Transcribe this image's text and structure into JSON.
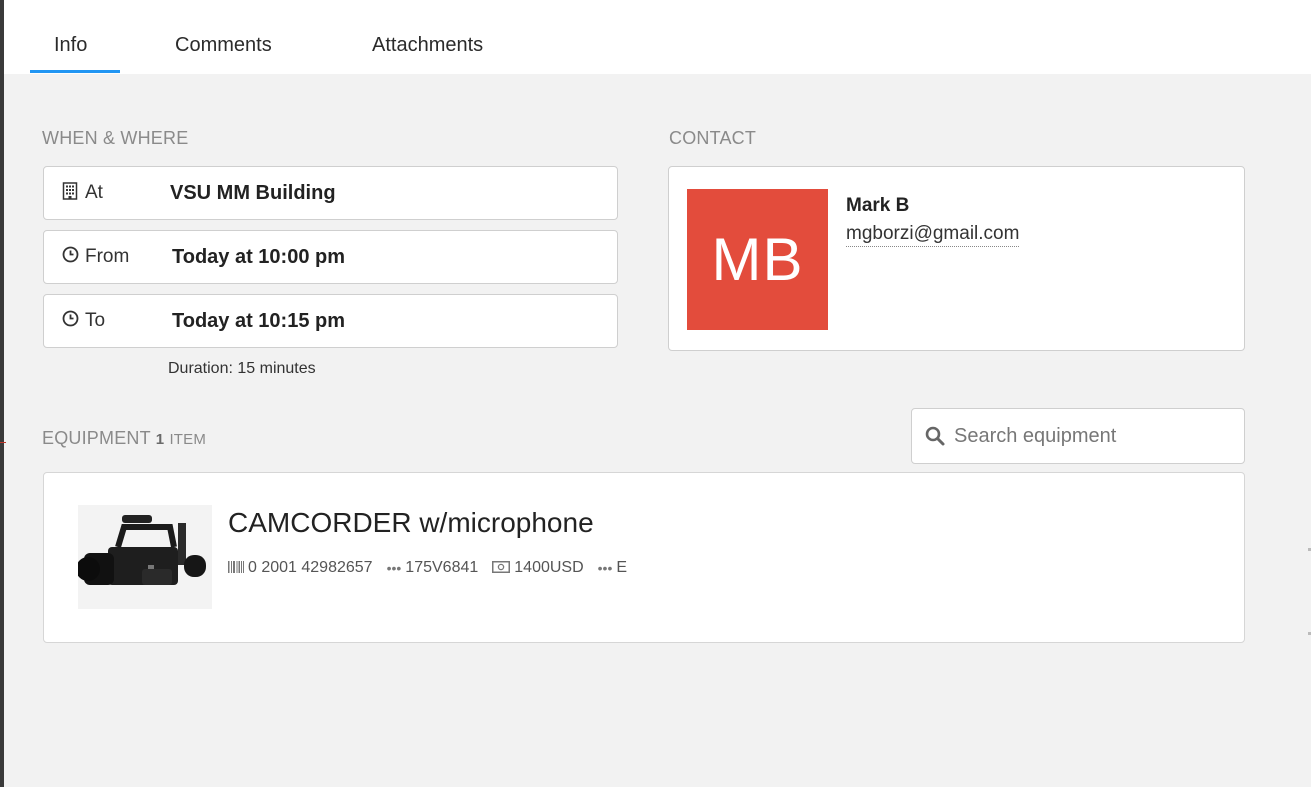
{
  "tabs": [
    {
      "label": "Info",
      "active": true
    },
    {
      "label": "Comments",
      "active": false
    },
    {
      "label": "Attachments",
      "active": false
    }
  ],
  "accent_color": "#2196f3",
  "when_where": {
    "title": "WHEN & WHERE",
    "at": {
      "icon": "building-icon",
      "label": "At",
      "value": "VSU MM Building"
    },
    "from": {
      "icon": "clock-icon",
      "label": "From",
      "value": "Today at 10:00 pm"
    },
    "to": {
      "icon": "clock-icon",
      "label": "To",
      "value": "Today at 10:15 pm"
    },
    "duration": "Duration: 15 minutes"
  },
  "contact": {
    "title": "CONTACT",
    "initials": "MB",
    "avatar_color": "#e34c3c",
    "name": "Mark B",
    "email": "mgborzi@gmail.com"
  },
  "equipment": {
    "title": "EQUIPMENT",
    "count": "1",
    "count_unit": "ITEM",
    "search_placeholder": "Search equipment",
    "items": [
      {
        "name": "CAMCORDER w/microphone",
        "barcode": "0 2001 42982657",
        "serial": "175V6841",
        "price": "1400USD",
        "code": "E"
      }
    ]
  }
}
